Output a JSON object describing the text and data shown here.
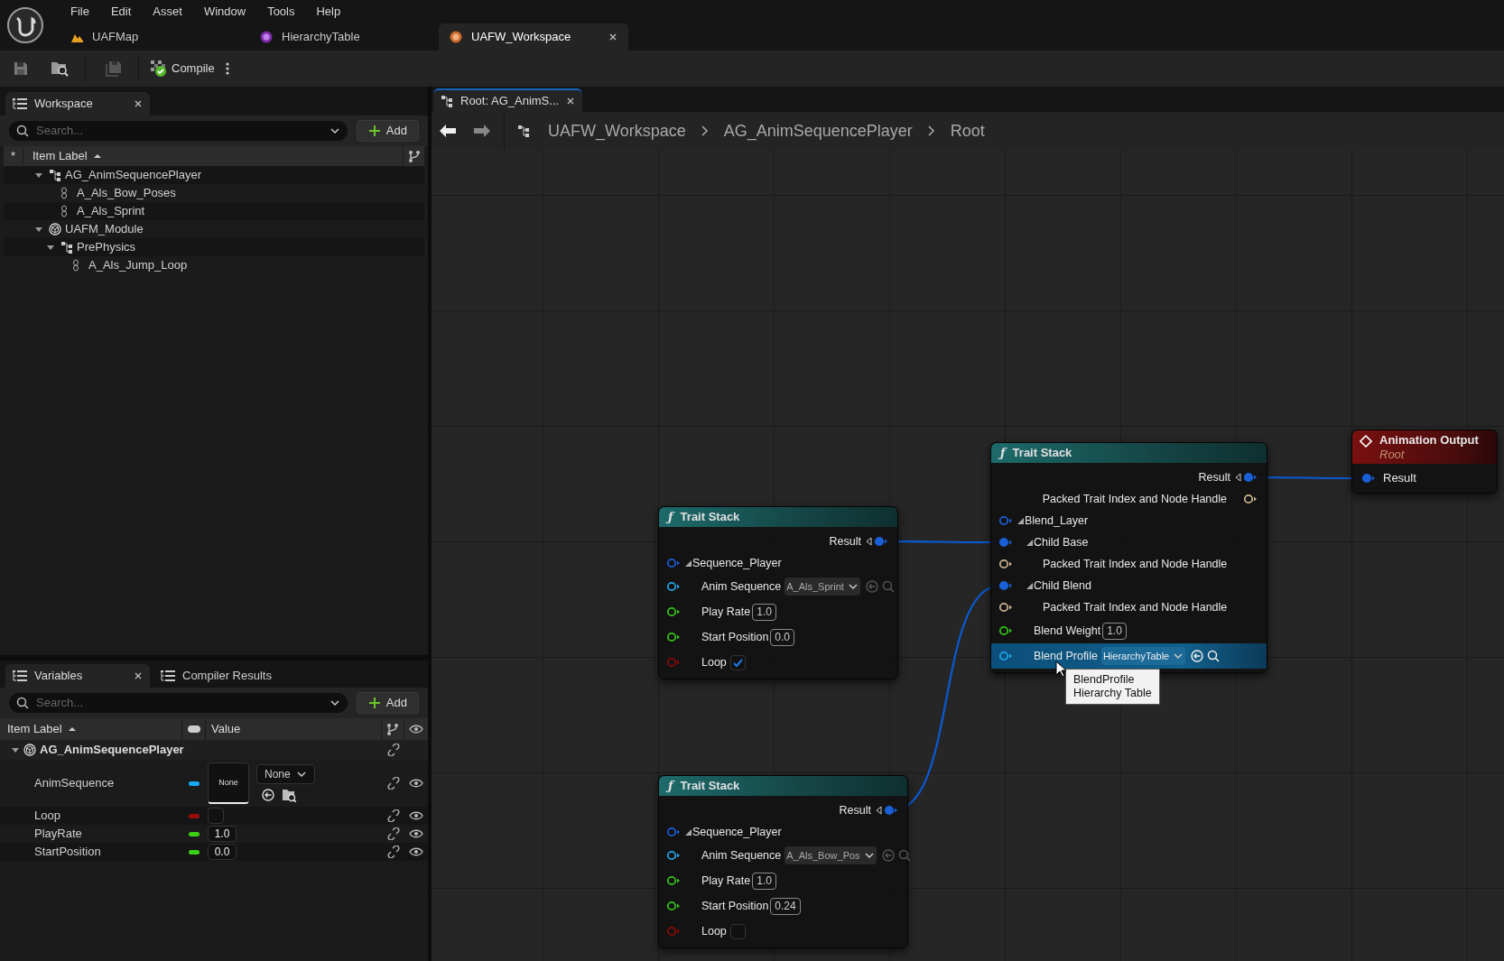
{
  "menu": [
    "File",
    "Edit",
    "Asset",
    "Window",
    "Tools",
    "Help"
  ],
  "document_tabs": [
    {
      "label": "UAFMap",
      "kind": "map",
      "selected": false
    },
    {
      "label": "HierarchyTable",
      "kind": "table",
      "selected": false
    },
    {
      "label": "UAFW_Workspace",
      "kind": "workspace",
      "selected": true
    }
  ],
  "toolbar": {
    "compile": "Compile"
  },
  "workspace_panel": {
    "tab": "Workspace",
    "search": {
      "placeholder": "Search..."
    },
    "add": "Add",
    "column": "Item Label",
    "star": "*",
    "tree": [
      {
        "label": "AG_AnimSequencePlayer",
        "kind": "graph",
        "expanded": true,
        "children": [
          {
            "label": "A_Als_Bow_Poses",
            "kind": "asset"
          },
          {
            "label": "A_Als_Sprint",
            "kind": "asset"
          }
        ]
      },
      {
        "label": "UAFM_Module",
        "kind": "module",
        "expanded": true,
        "children": [
          {
            "label": "PrePhysics",
            "kind": "graph",
            "expanded": true,
            "children": [
              {
                "label": "A_Als_Jump_Loop",
                "kind": "asset"
              }
            ]
          }
        ]
      }
    ]
  },
  "variables_panel": {
    "tabs": [
      {
        "label": "Variables",
        "selected": true
      },
      {
        "label": "Compiler Results",
        "selected": false
      }
    ],
    "search": {
      "placeholder": "Search..."
    },
    "add": "Add",
    "columns": [
      "Item Label",
      "Value"
    ],
    "group": {
      "label": "AG_AnimSequencePlayer",
      "expanded": true,
      "children": [
        {
          "name": "AnimSequence",
          "color": "#1aa8f0",
          "kind": "asset",
          "thumbnail": "None",
          "value": "None"
        },
        {
          "name": "Loop",
          "color": "#9a0c0c",
          "kind": "bool",
          "checked": false
        },
        {
          "name": "PlayRate",
          "color": "#3ccf18",
          "kind": "number",
          "value": "1.0"
        },
        {
          "name": "StartPosition",
          "color": "#3ccf18",
          "kind": "number",
          "value": "0.0"
        }
      ]
    }
  },
  "graph_tab": {
    "label": "Root: AG_AnimS..."
  },
  "breadcrumb": [
    "UAFW_Workspace",
    "AG_AnimSequencePlayer",
    "Root"
  ],
  "nodes": [
    {
      "kind": "trait_stack",
      "icon": "ƒ",
      "title": "Trait Stack",
      "outputs": [
        {
          "label": "Result",
          "kind": "result",
          "color": "#1a5fd6",
          "connected": true
        }
      ],
      "pins": [
        {
          "label": "Sequence_Player",
          "kind": "pin",
          "color": "#1a5fd6",
          "connected": false,
          "expanded": true,
          "children": [
            {
              "label": "Anim Sequence",
              "kind": "asset",
              "color": "#22a3e6",
              "connected": false,
              "value": "A_Als_Sprint"
            },
            {
              "label": "Play Rate",
              "kind": "number",
              "color": "#35c318",
              "connected": false,
              "value": "1.0"
            },
            {
              "label": "Start Position",
              "kind": "number",
              "color": "#35c318",
              "connected": false,
              "value": "0.0"
            },
            {
              "label": "Loop",
              "kind": "checkbox",
              "color": "#8a0a0a",
              "connected": false,
              "checked": true
            }
          ]
        }
      ]
    },
    {
      "kind": "trait_stack",
      "icon": "ƒ",
      "title": "Trait Stack",
      "outputs": [
        {
          "label": "Result",
          "kind": "result",
          "color": "#1a5fd6",
          "connected": true
        }
      ],
      "pins": [
        {
          "label": "Sequence_Player",
          "kind": "pin",
          "color": "#1a5fd6",
          "connected": false,
          "expanded": true,
          "children": [
            {
              "label": "Anim Sequence",
              "kind": "asset",
              "color": "#22a3e6",
              "connected": false,
              "value": "A_Als_Bow_Pos"
            },
            {
              "label": "Play Rate",
              "kind": "number",
              "color": "#35c318",
              "connected": false,
              "value": "1.0"
            },
            {
              "label": "Start Position",
              "kind": "number",
              "color": "#35c318",
              "connected": false,
              "value": "0.24"
            },
            {
              "label": "Loop",
              "kind": "checkbox",
              "color": "#8a0a0a",
              "connected": false,
              "checked": false
            }
          ]
        }
      ]
    },
    {
      "kind": "trait_stack",
      "icon": "ƒ",
      "title": "Trait Stack",
      "outputs": [
        {
          "label": "Result",
          "kind": "result",
          "color": "#1a5fd6",
          "connected": true
        },
        {
          "label": "Packed Trait Index and Node Handle",
          "kind": "pin",
          "color": "#c9b28e",
          "connected": false
        }
      ],
      "pins": [
        {
          "label": "Blend_Layer",
          "kind": "pin",
          "color": "#1a5fd6",
          "connected": false,
          "expanded": true,
          "children": [
            {
              "label": "Child Base",
              "kind": "pin",
              "color": "#1a5fd6",
              "connected": true,
              "expanded": true,
              "children": [
                {
                  "label": "Packed Trait Index and Node Handle",
                  "kind": "pin",
                  "color": "#c9b28e",
                  "connected": false
                }
              ]
            },
            {
              "label": "Child Blend",
              "kind": "pin",
              "color": "#1a5fd6",
              "connected": true,
              "expanded": true,
              "children": [
                {
                  "label": "Packed Trait Index and Node Handle",
                  "kind": "pin",
                  "color": "#c9b28e",
                  "connected": false
                }
              ]
            },
            {
              "label": "Blend Weight",
              "kind": "number",
              "color": "#35c318",
              "connected": false,
              "value": "1.0"
            },
            {
              "label": "Blend Profile",
              "kind": "asset",
              "color": "#22a3e6",
              "connected": false,
              "value": "HierarchyTable",
              "hovered": true
            }
          ]
        }
      ]
    },
    {
      "kind": "output",
      "title": "Animation Output",
      "subtitle": "Root",
      "pins": [
        {
          "label": "Result",
          "kind": "pin",
          "color": "#1a5fd6",
          "connected": true
        }
      ]
    }
  ],
  "tooltip": [
    "BlendProfile",
    "Hierarchy Table"
  ]
}
